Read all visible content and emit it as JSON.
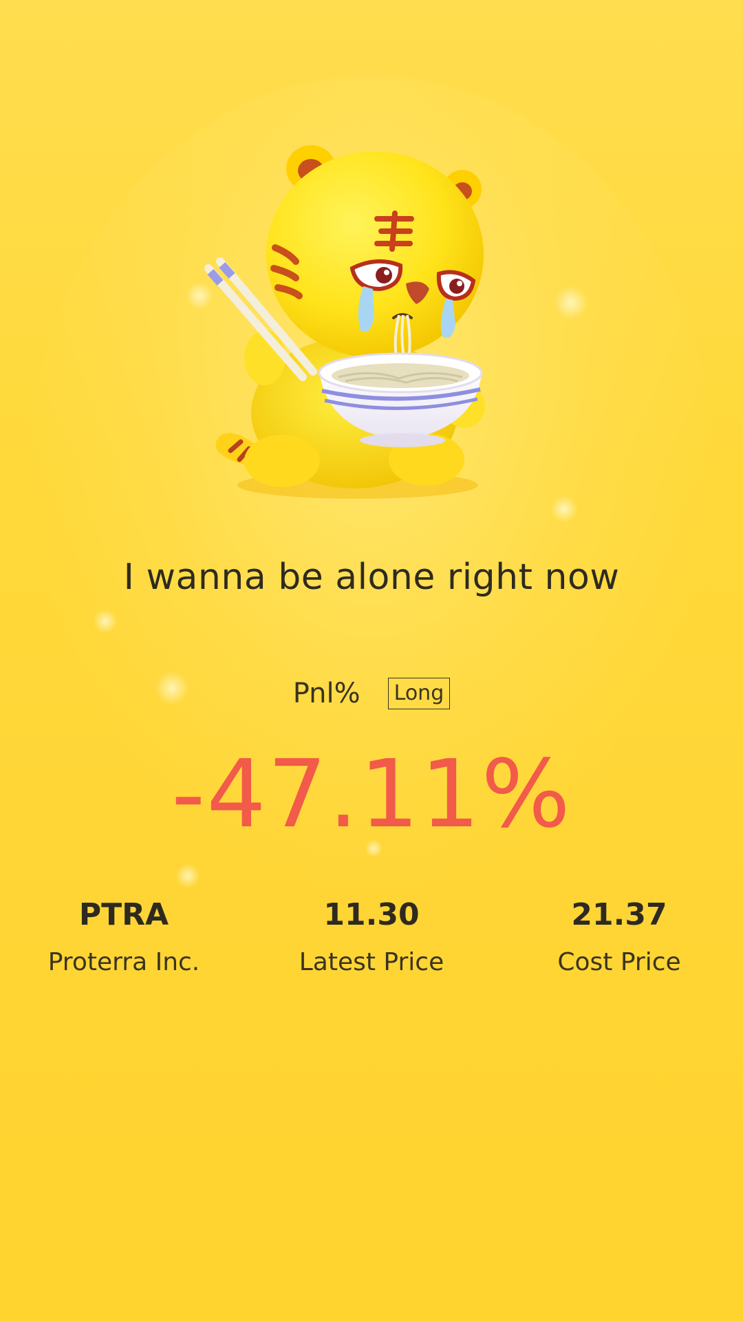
{
  "headline": "I wanna be alone right now",
  "pnl": {
    "label": "Pnl%",
    "direction": "Long",
    "value": "-47.11%"
  },
  "stats": [
    {
      "value": "PTRA",
      "label": "Proterra Inc."
    },
    {
      "value": "11.30",
      "label": "Latest Price"
    },
    {
      "value": "21.37",
      "label": "Cost Price"
    }
  ],
  "colors": {
    "background": "#FFD93A",
    "loss": "#F25A4A",
    "text": "#2E2A20"
  },
  "illustration": {
    "icon": "crying-tiger-eating-noodles-icon"
  }
}
